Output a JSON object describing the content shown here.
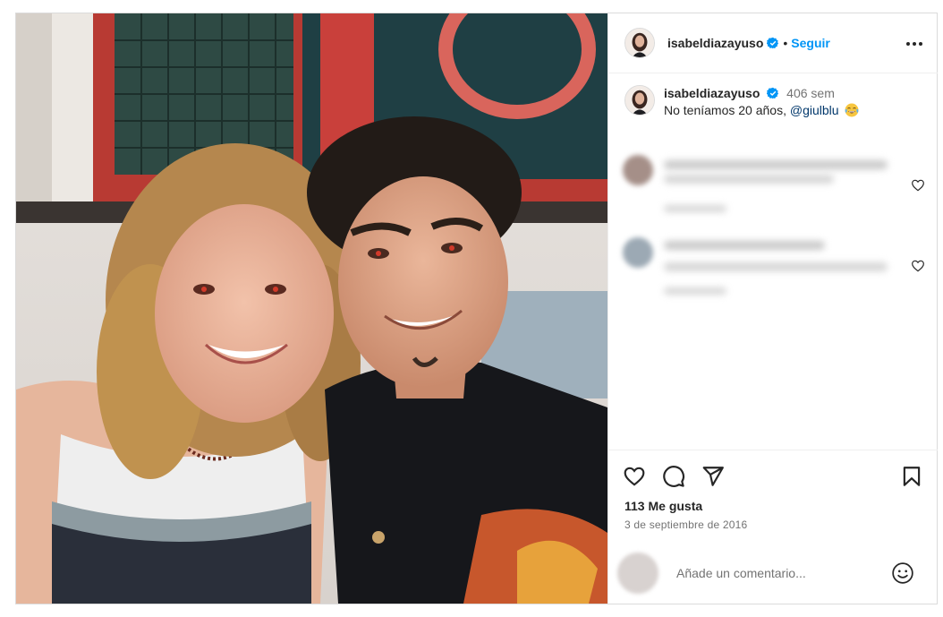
{
  "post": {
    "username": "isabeldiazayuso",
    "verified_icon": "verified-badge-icon",
    "separator": "•",
    "follow_label": "Seguir",
    "more_icon": "more-options-icon",
    "photo_description_icon": "post-photo"
  },
  "caption": {
    "username": "isabeldiazayuso",
    "time": "406 sem",
    "text": "No teníamos 20 años,",
    "mention": "@giulblu",
    "emoji": "laughing-tears-emoji"
  },
  "comments": [
    {
      "hidden": true
    },
    {
      "hidden": true
    }
  ],
  "actions": {
    "like_icon": "heart-icon",
    "comment_icon": "comment-icon",
    "share_icon": "send-icon",
    "save_icon": "bookmark-icon",
    "likes": "113 Me gusta",
    "date": "3 de septiembre de 2016"
  },
  "add_comment": {
    "placeholder": "Añade un comentario...",
    "emoji_icon": "smiley-icon"
  },
  "colors": {
    "accent": "#0095f6",
    "mention": "#00376b",
    "muted": "#737373",
    "verified": "#0095f6"
  }
}
